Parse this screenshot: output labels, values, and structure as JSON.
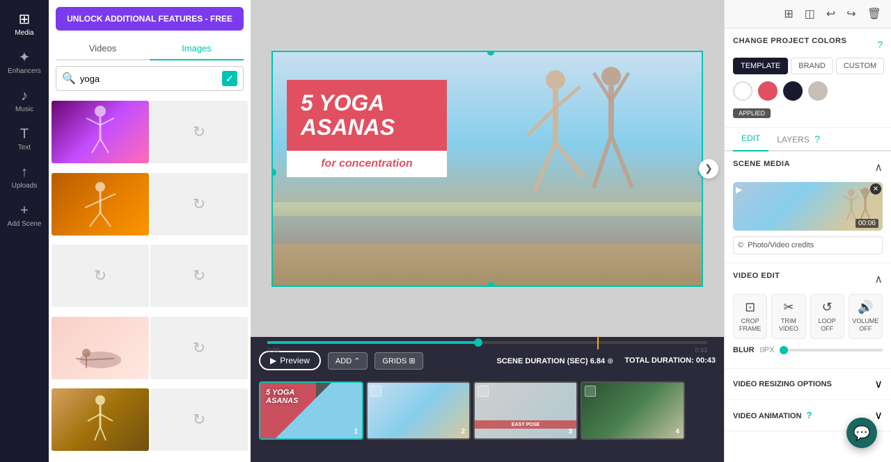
{
  "sidebar": {
    "items": [
      {
        "id": "media",
        "label": "Media",
        "icon": "⊞",
        "active": true
      },
      {
        "id": "enhancers",
        "label": "Enhancers",
        "icon": "✦"
      },
      {
        "id": "music",
        "label": "Music",
        "icon": "♪"
      },
      {
        "id": "text",
        "label": "Text",
        "icon": "T"
      },
      {
        "id": "uploads",
        "label": "Uploads",
        "icon": "↑"
      },
      {
        "id": "add-scene",
        "label": "Add Scene",
        "icon": "+"
      }
    ]
  },
  "media_panel": {
    "unlock_btn": "UNLOCK ADDITIONAL FEATURES - FREE",
    "tabs": [
      "Videos",
      "Images"
    ],
    "active_tab": "Images",
    "search_placeholder": "yoga",
    "search_value": "yoga"
  },
  "canvas": {
    "text_main": "5 YOGA\nASANAS",
    "text_sub": "for concentration",
    "nav_right": "❯"
  },
  "timeline": {
    "play_label": "▶ Preview",
    "add_label": "ADD ⌃",
    "grids_label": "GRIDS ⊞",
    "scene_duration_label": "SCENE DURATION (SEC)",
    "scene_duration_value": "6.84",
    "total_duration_label": "TOTAL DURATION:",
    "total_duration_value": "00:43",
    "thumbnails": [
      {
        "id": 1,
        "label": "5 YOGA\nASANAS",
        "num": "1",
        "active": true
      },
      {
        "id": 2,
        "label": "",
        "num": "2",
        "active": false
      },
      {
        "id": 3,
        "label": "",
        "num": "3",
        "active": false
      },
      {
        "id": 4,
        "label": "",
        "num": "4",
        "active": false
      }
    ]
  },
  "right_panel": {
    "top_icons": [
      "⊞",
      "◫",
      "↩",
      "↪",
      "🗑"
    ],
    "change_project_colors": "CHANGE PROJECT COLORS",
    "color_tabs": [
      "TEMPLATE",
      "BRAND",
      "CUSTOM"
    ],
    "active_color_tab": "TEMPLATE",
    "swatches": [
      {
        "color": "#ffffff",
        "selected": false
      },
      {
        "color": "#e05060",
        "selected": false
      },
      {
        "color": "#1a1a2e",
        "selected": false
      },
      {
        "color": "#c8c0b8",
        "selected": false
      }
    ],
    "applied_label": "APPLIED",
    "edit_tab": "EDIT",
    "layers_tab": "LAYERS",
    "scene_media_title": "SCENE MEDIA",
    "video_duration": "00:06",
    "credits_label": "Photo/Video credits",
    "video_edit_title": "VIDEO EDIT",
    "tools": [
      {
        "id": "crop-frame",
        "icon": "⊡",
        "label": "CROP FRAME"
      },
      {
        "id": "trim-video",
        "icon": "✂",
        "label": "TRIM VIDEO"
      },
      {
        "id": "loop-off",
        "icon": "↺",
        "label": "LOOP OFF"
      },
      {
        "id": "volume-off",
        "icon": "🔊",
        "label": "VOLUME OFF"
      }
    ],
    "blur_label": "BLUR",
    "blur_value": "0PX",
    "video_resizing_title": "VIDEO RESIZING OPTIONS",
    "video_animation_title": "VIDEO ANIMATION"
  }
}
